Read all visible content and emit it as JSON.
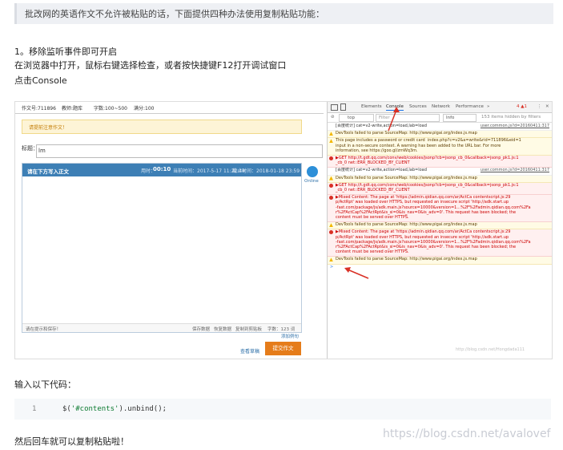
{
  "intro": "批改网的英语作文不允许被粘贴的话，下面提供四种办法使用复制粘贴功能：",
  "step1": "1。移除监听事件即可开启",
  "step1_line2": "在浏览器中打开，鼠标右键选择检查，或者按快捷键F12打开调试窗口",
  "step1_line3": "点击Console",
  "page": {
    "info": [
      "作文号:711896",
      "教师:题库",
      "字数:100~500",
      "满分:100"
    ],
    "warning": "请提前注意作文！",
    "title_label": "标题：",
    "title_value": "lm",
    "editor_header": "请在下方写入正文",
    "editor_timer_label": "用时：",
    "editor_timer": "00:10",
    "editor_time_current": "当前时间：2017-5-17 11:22:44",
    "editor_deadline": "截止时间：2018-01-18 23:59",
    "online": "Online",
    "editor_footer_left": "请在提示和保存！",
    "editor_footer_actions": [
      "保存数据",
      "恢复数据",
      "复制到剪贴板",
      "字数：123 词"
    ],
    "add_example": "添加例句",
    "lookup": "查看草稿",
    "submit": "提交作文"
  },
  "devtools": {
    "tabs": [
      "Elements",
      "Console",
      "Sources",
      "Network",
      "Performance",
      "»"
    ],
    "active_tab": "Console",
    "badge": "4 ▲1",
    "context": "top",
    "filter_placeholder": "Filter",
    "level": "Info",
    "hidden": "153 items hidden by filters",
    "logs": [
      {
        "kind": "plain",
        "text": "[百度统计] cat=v2-write,action=load,lab=load",
        "src": "user.common.js?d=20160411:317"
      },
      {
        "kind": "warn",
        "text": "DevTools failed to parse SourceMap: http://www.pigai.org/index.js.map",
        "src": ""
      },
      {
        "kind": "warn",
        "text": "This page includes a password or credit card  index.php?c=v2&a=write&rid=711896&eid=1\ninput in a non-secure context. A warning has been added to the URL bar. For more\ninformation, see https://goo.gl/zmWq3m.",
        "src": ""
      },
      {
        "kind": "err",
        "text": "▶GET http://t.gdt.qq.com/conv/web/cookies/jsonp?cb=jsonp_cb_0&callback=jsonp_pk1.js:1\n_cb_0 net::ERR_BLOCKED_BY_CLIENT",
        "src": ""
      },
      {
        "kind": "plain",
        "text": "[百度统计] cat=v2-write,action=load,lab=load",
        "src": "user.common.js?d=20160411:317"
      },
      {
        "kind": "warn",
        "text": "DevTools failed to parse SourceMap: http://www.pigai.org/index.js.map",
        "src": ""
      },
      {
        "kind": "err",
        "text": "▶GET http://t.gdt.qq.com/conv/web/cookies/jsonp?cb=jsonp_cb_0&callback=jsonp_pk1.js:1\n_cb_0 net::ERR_BLOCKED_BY_CLIENT",
        "src": ""
      },
      {
        "kind": "err",
        "text": "▶Mixed Content: The page at 'https://admin.qidian.qq.com/ar/ActCa contentscript.js:29\np/ActRpt' was loaded over HTTPS, but requested an insecure script 'http://adk.start.up\n-fast.com/package/js/adk.main.js?source=10000&version=1...%2F%2Fadmin.qidian.qq.com%2Fa\nr%2FActCap%2FActRpt&is_si=0&is_nav=0&is_adv=0'. This request has been blocked; the\ncontent must be served over HTTPS.",
        "src": ""
      },
      {
        "kind": "warn",
        "text": "DevTools failed to parse SourceMap: http://www.pigai.org/index.js.map",
        "src": ""
      },
      {
        "kind": "err",
        "text": "▶Mixed Content: The page at 'https://admin.qidian.qq.com/ar/ActCa contentscript.js:29\np/ActRpt' was loaded over HTTPS, but requested an insecure script 'http://adk.start.up\n-fast.com/package/js/adk.main.js?source=10000&version=1...%2F%2Fadmin.qidian.qq.com%2Fa\nr%2FActCap%2FActRpt&is_si=0&is_nav=0&is_adv=0'. This request has been blocked; the\ncontent must be served over HTTPS.",
        "src": ""
      },
      {
        "kind": "warn",
        "text": "DevTools failed to parse SourceMap: http://www.pigai.org/index.js.map",
        "src": ""
      }
    ],
    "prompt": ">",
    "watermark": "http://blog.csdn.net/Hongdada111"
  },
  "input_label": "输入以下代码：",
  "code": {
    "line_no": "1",
    "prefix": "$(",
    "string": "'#contents'",
    "suffix": ").unbind();"
  },
  "outro": "然后回车就可以复制粘贴啦！",
  "watermark": "https://blog.csdn.net/avalovef"
}
